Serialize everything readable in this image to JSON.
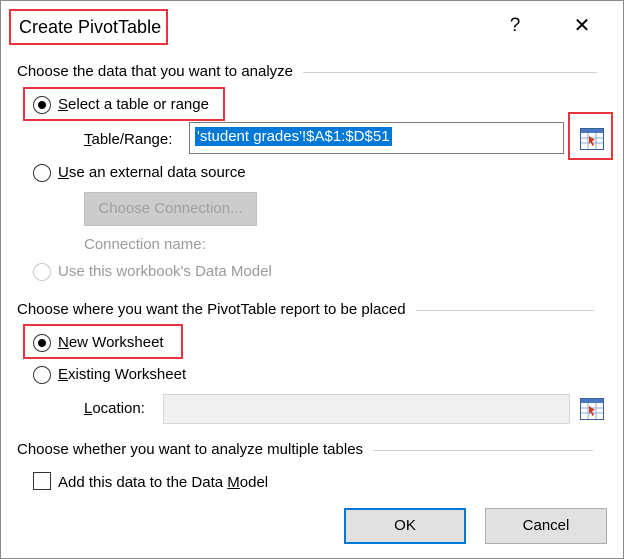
{
  "title": "Create PivotTable",
  "title_buttons": {
    "help": "?",
    "close": "✕"
  },
  "section1": {
    "heading": "Choose the data that you want to analyze",
    "opt_table": {
      "u": "S",
      "rest": "elect a table or range",
      "selected": true
    },
    "table_range": {
      "u": "T",
      "rest": "able/Range:",
      "value": "'student grades'!$A$1:$D$51"
    },
    "opt_external": {
      "u": "U",
      "rest": "se an external data source",
      "selected": false
    },
    "choose_connection": "Choose Connection...",
    "connection_name": "Connection name:",
    "opt_model": {
      "label": "Use this workbook's Data Model",
      "enabled": false
    }
  },
  "section2": {
    "heading": "Choose where you want the PivotTable report to be placed",
    "opt_new": {
      "u": "N",
      "rest": "ew Worksheet",
      "selected": true
    },
    "opt_existing": {
      "u": "E",
      "rest": "xisting Worksheet",
      "selected": false
    },
    "location": {
      "u": "L",
      "rest": "ocation:",
      "value": ""
    }
  },
  "section3": {
    "heading": "Choose whether you want to analyze multiple tables",
    "add_model": {
      "pre": "Add this data to the Data ",
      "u": "M",
      "post": "odel",
      "checked": false
    }
  },
  "buttons": {
    "ok": "OK",
    "cancel": "Cancel"
  },
  "colors": {
    "highlight": "#e8343f",
    "focus": "#0078d7",
    "selection": "#0078d7"
  }
}
